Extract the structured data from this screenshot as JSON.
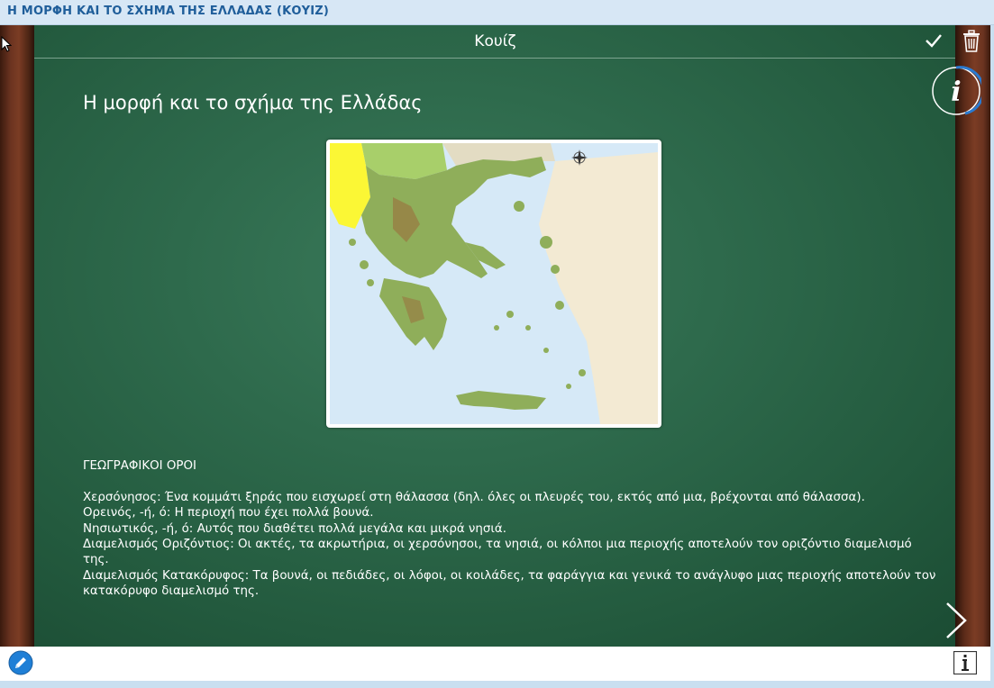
{
  "window": {
    "title": "Η ΜΟΡΦΗ ΚΑΙ ΤΟ ΣΧΗΜΑ ΤΗΣ ΕΛΛΑΔΑΣ (ΚΟΥΙΖ)"
  },
  "toolbar": {
    "header": "Κουίζ",
    "check_icon": "check-icon",
    "trash_icon": "trash-icon",
    "info_icon": "info-icon"
  },
  "content": {
    "heading": "Η μορφή και το σχήμα της Ελλάδας",
    "section_title": "ΓΕΩΓΡΑΦΙΚΟΙ ΟΡΟΙ",
    "terms": [
      "Χερσόνησος: Ένα κομμάτι ξηράς που εισχωρεί στη θάλασσα (δηλ. όλες οι πλευρές του, εκτός από μια, βρέχονται από θάλασσα).",
      "Ορεινός, -ή, ό: Η περιοχή που έχει πολλά βουνά.",
      "Νησιωτικός, -ή, ό: Αυτός που διαθέτει πολλά μεγάλα και μικρά νησιά.",
      "Διαμελισμός Οριζόντιος: Οι ακτές, τα ακρωτήρια, οι χερσόνησοι, τα νησιά, οι κόλποι μια περιοχής αποτελούν τον οριζόντιο διαμελισμό της.",
      "Διαμελισμός Κατακόρυφος: Τα βουνά, οι πεδιάδες, οι λόφοι, οι κοιλάδες, τα φαράγγια και γενικά το ανάγλυφο μιας περιοχής αποτελούν τον κατακόρυφο διαμελισμό της."
    ]
  },
  "colors": {
    "sea": "#d6e9f7",
    "land_greece": "#8fae5a",
    "turkey": "#f3ead3",
    "albania": "#fbf735",
    "north": "#a8cf6a",
    "board": "#2e6a4c"
  }
}
